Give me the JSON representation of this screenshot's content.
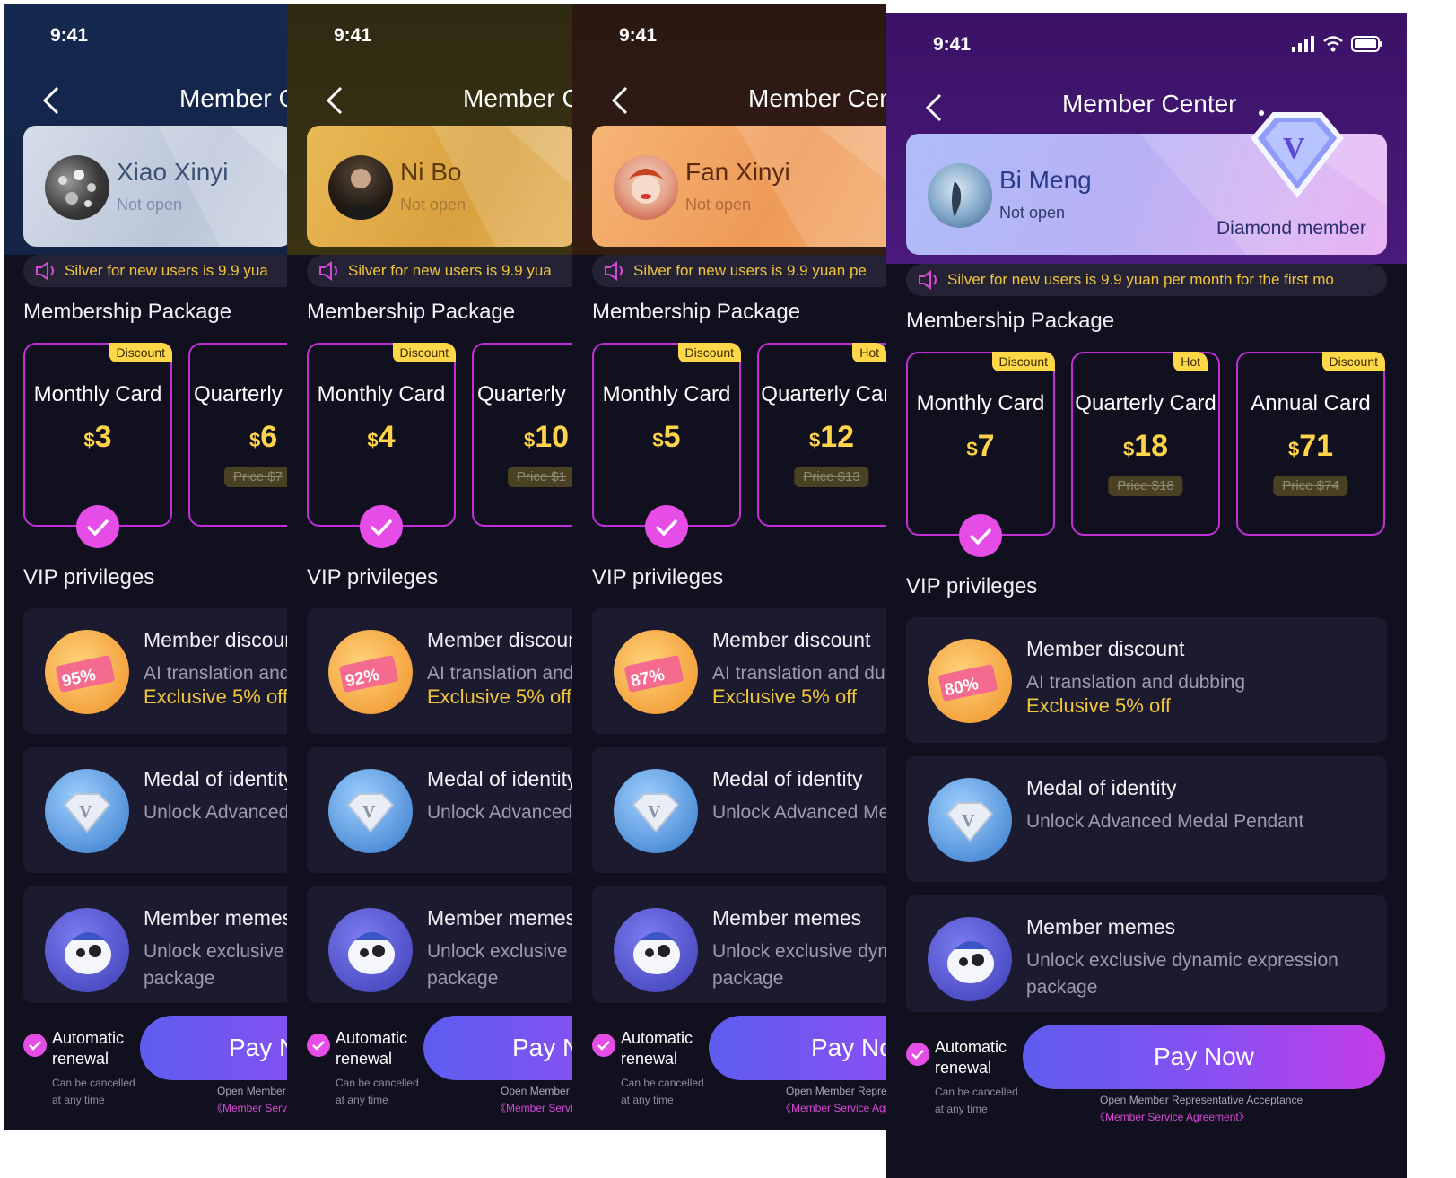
{
  "common": {
    "time": "9:41",
    "notice_full": "Silver for new users is 9.9 yuan per month for the first mo",
    "notice_p1": "Silver for new users is 9.9 yua",
    "notice_p3": "Silver for new users is 9.9 yuan pe",
    "not_open": "Not open",
    "package_title": "Membership Package",
    "vip_title": "VIP privileges",
    "badge_discount": "Discount",
    "badge_hot": "Hot",
    "card_monthly": "Monthly Card",
    "card_quarterly": "Quarterly Card",
    "card_annual": "Annual Card",
    "priv_discount_title": "Member discount",
    "priv_discount_desc": "AI translation and dubbing",
    "priv_discount_offer": "Exclusive 5% off",
    "priv_medal_title": "Medal of identity",
    "priv_medal_desc": "Unlock Advanced Medal Pendant",
    "priv_memes_title": "Member memes",
    "priv_memes_desc1": "Unlock exclusive dynamic expression",
    "priv_memes_desc2": "package",
    "renew_label1": "Automatic",
    "renew_label2": "renewal",
    "renew_note1": "Can be cancelled",
    "renew_note2": "at any time",
    "pay_now": "Pay Now",
    "agreement1": "Open Member Representative Acceptance",
    "agreement2": "《Member Service Agreement》",
    "nav_title": "Member Center"
  },
  "screens": [
    {
      "user": "Xiao Xinyi",
      "nav_title_partial": "Member C",
      "monthly_price": "3",
      "quarterly_price": "6",
      "quarterly_orig": "Price $7",
      "discount_pct": "95%",
      "card_color": "#c8d3e4"
    },
    {
      "user": "Ni Bo",
      "nav_title_partial": "Member C",
      "monthly_price": "4",
      "quarterly_price": "10",
      "quarterly_orig": "Price $1",
      "discount_pct": "92%",
      "card_color": "#e6b04e"
    },
    {
      "user": "Fan Xinyi",
      "nav_title_partial": "Member Cen",
      "monthly_price": "5",
      "quarterly_price": "12",
      "quarterly_orig": "Price $13",
      "discount_pct": "87%",
      "card_color": "#f0a560"
    },
    {
      "user": "Bi Meng",
      "level": "Diamond member",
      "monthly_price": "7",
      "quarterly_price": "18",
      "quarterly_orig": "Price $18",
      "annual_price": "71",
      "annual_orig": "Price $74",
      "discount_pct": "80%",
      "card_color": "#9fb5f6"
    }
  ]
}
